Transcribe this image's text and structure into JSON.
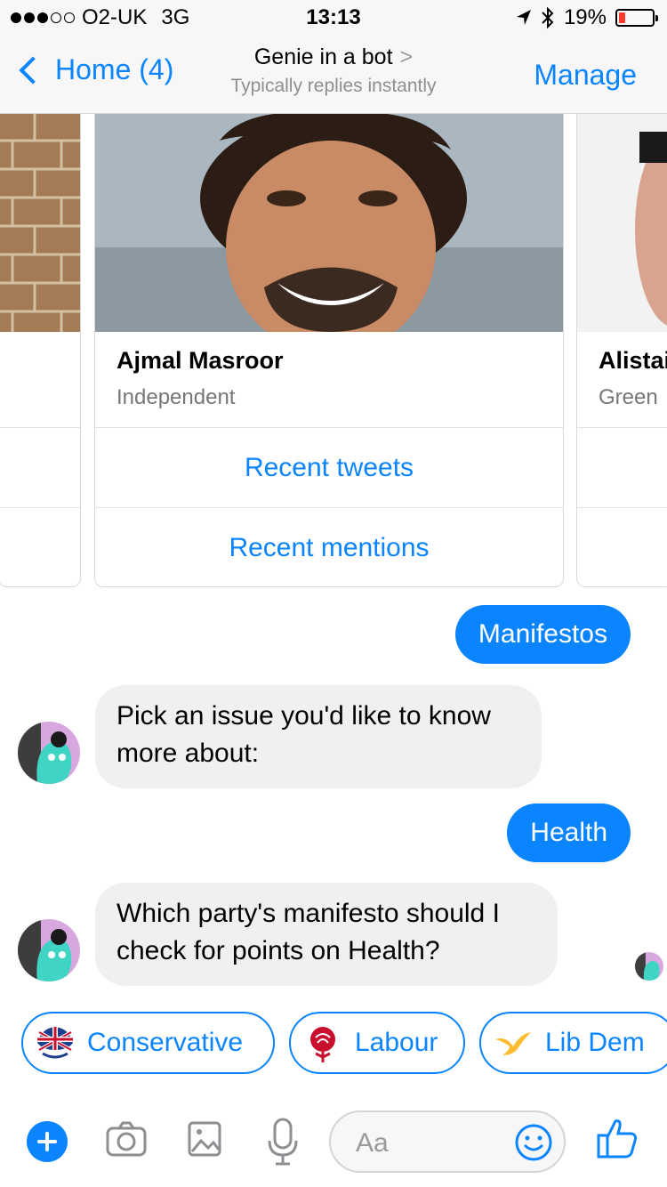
{
  "status_bar": {
    "carrier": "O2-UK",
    "network": "3G",
    "time": "13:13",
    "battery": "19%",
    "battery_level": 0.19,
    "battery_color": "#ff3b30",
    "signal_bars": 3,
    "icons": [
      "location-arrow-icon",
      "bluetooth-icon",
      "battery-icon"
    ]
  },
  "nav": {
    "back_label": "Home (4)",
    "title": "Genie in a bot",
    "title_chevron": ">",
    "subtitle": "Typically replies instantly",
    "manage_label": "Manage"
  },
  "carousel": {
    "cards": [
      {
        "name": "",
        "party": "",
        "image": "brick-wall-photo"
      },
      {
        "name": "Ajmal Masroor",
        "party": "Independent",
        "image": "portrait-photo",
        "buttons": [
          "Recent tweets",
          "Recent mentions"
        ]
      },
      {
        "name": "Alistai",
        "party": "Green",
        "image": "portrait-photo"
      }
    ]
  },
  "messages": [
    {
      "from": "user",
      "text": "Manifestos"
    },
    {
      "from": "bot",
      "text": "Pick an issue you'd like to know more about:"
    },
    {
      "from": "user",
      "text": "Health"
    },
    {
      "from": "bot",
      "text": "Which party's manifesto should I check for points on Health?"
    }
  ],
  "quick_replies": [
    {
      "label": "Conservative",
      "icon": "union-jack-tree-icon"
    },
    {
      "label": "Labour",
      "icon": "red-rose-icon"
    },
    {
      "label": "Lib Dem",
      "icon": "yellow-bird-icon"
    }
  ],
  "composer": {
    "placeholder": "Aa",
    "icons": [
      "plus-icon",
      "camera-icon",
      "image-icon",
      "microphone-icon",
      "emoji-icon",
      "thumbs-up-icon"
    ]
  },
  "colors": {
    "accent": "#0a84ff",
    "bubble_incoming": "#f0f0f0",
    "bubble_outgoing": "#0a84ff"
  }
}
